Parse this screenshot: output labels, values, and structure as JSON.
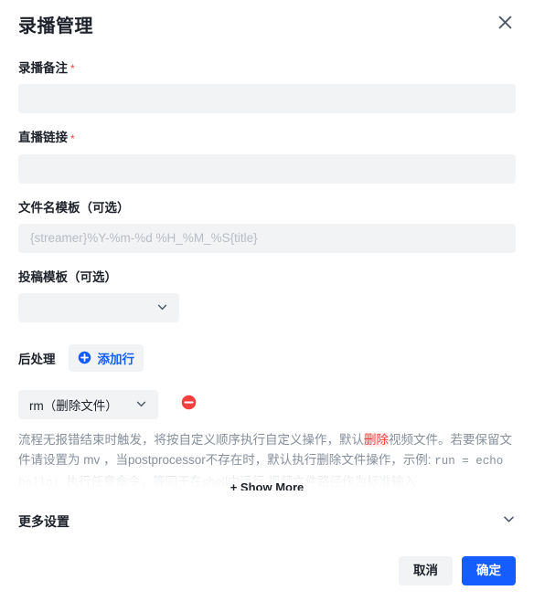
{
  "dialog": {
    "title": "录播管理",
    "close_icon": "close-icon"
  },
  "fields": {
    "note": {
      "label": "录播备注",
      "required_mark": "*",
      "value": "",
      "placeholder": ""
    },
    "live_url": {
      "label": "直播链接",
      "required_mark": "*",
      "value": "",
      "placeholder": ""
    },
    "filename_template": {
      "label": "文件名模板（可选）",
      "value": "",
      "placeholder": "{streamer}%Y-%m-%d %H_%M_%S{title}"
    },
    "upload_template": {
      "label": "投稿模板（可选）",
      "value": "",
      "chevron_icon": "chevron-down-icon"
    }
  },
  "postprocess": {
    "label": "后处理",
    "add_row_label": "添加行",
    "plus_icon": "plus-circle-icon",
    "rows": [
      {
        "action": "rm（删除文件）",
        "chevron_icon": "chevron-down-icon",
        "remove_icon": "minus-circle-icon"
      }
    ],
    "description_parts": [
      {
        "text": "流程无报错结束时触发，将按自定义顺序执行自定义操作，默认",
        "style": "normal"
      },
      {
        "text": "删除",
        "style": "red-highlight"
      },
      {
        "text": "视频文件。若要保留文件请设置为 mv ，当postprocessor不存在时，默认执行删除文件操作，示例: ",
        "style": "normal"
      },
      {
        "text": "run = echo hello! ",
        "style": "mono"
      },
      {
        "text": "执行任意命令，等同于在shell中运行,视频文件路径作为标准输入",
        "style": "normal"
      }
    ],
    "show_more_label": "+ Show More"
  },
  "more_settings": {
    "label": "更多设置",
    "chevron_icon": "chevron-down-icon"
  },
  "footer": {
    "cancel_label": "取消",
    "confirm_label": "确定"
  },
  "colors": {
    "primary": "#165dff",
    "danger": "#f53f3f",
    "input_bg": "#f2f3f5",
    "muted_text": "#86909c"
  }
}
